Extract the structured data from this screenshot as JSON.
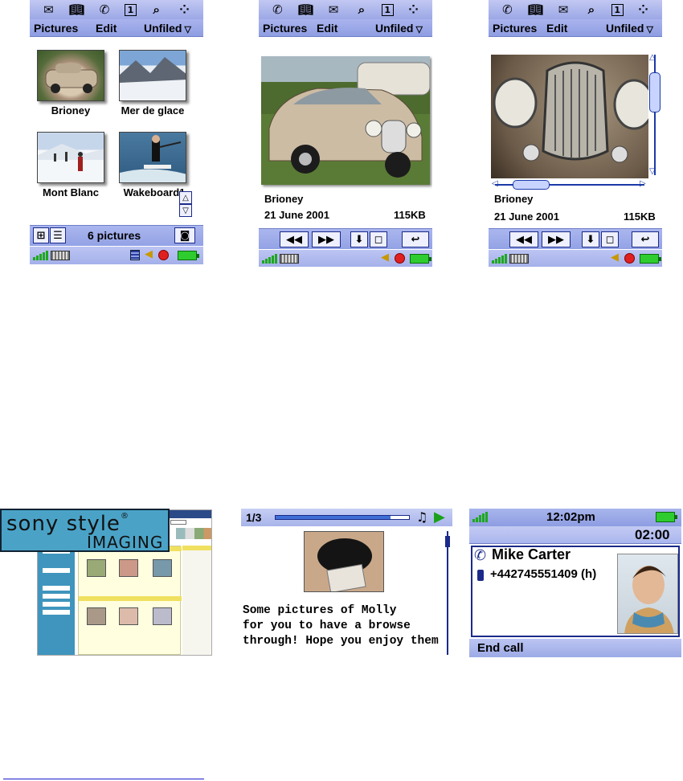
{
  "screens": [
    {
      "icons": [
        "envelope-icon",
        "book-icon",
        "phone-icon",
        "calendar-icon",
        "search-icon",
        "apps-icon"
      ],
      "menu": {
        "pictures": "Pictures",
        "edit": "Edit",
        "folder": "Unfiled"
      },
      "thumbnails": [
        {
          "caption": "Brioney",
          "icon": "car-photo"
        },
        {
          "caption": "Mer de glace",
          "icon": "glacier-photo"
        },
        {
          "caption": "Mont Blanc",
          "icon": "skiers-photo"
        },
        {
          "caption": "Wakeboard1",
          "icon": "wakeboard-photo"
        }
      ],
      "footer_count": "6 pictures"
    },
    {
      "icons": [
        "phone-icon",
        "book-icon",
        "envelope-icon",
        "search-icon",
        "calendar-icon",
        "apps-icon"
      ],
      "menu": {
        "pictures": "Pictures",
        "edit": "Edit",
        "folder": "Unfiled"
      },
      "picture": {
        "name": "Brioney",
        "date": "21 June 2001",
        "size": "115KB"
      }
    },
    {
      "icons": [
        "phone-icon",
        "book-icon",
        "envelope-icon",
        "search-icon",
        "calendar-icon",
        "apps-icon"
      ],
      "menu": {
        "pictures": "Pictures",
        "edit": "Edit",
        "folder": "Unfiled"
      },
      "picture": {
        "name": "Brioney",
        "date": "21 June 2001",
        "size": "115KB"
      }
    }
  ],
  "sony": {
    "title": "sony style",
    "subtitle": "IMAGING",
    "trademark": "®"
  },
  "player": {
    "counter": "1/3",
    "progress": 0.86,
    "message_lines": [
      "Some pictures of Molly",
      "for you to have a browse",
      "through! Hope you enjoy them"
    ]
  },
  "call": {
    "time": "12:02pm",
    "timer": "02:00",
    "name": "Mike Carter",
    "number": "+442745551409 (h)",
    "softkey": "End call"
  },
  "colors": {
    "bar_blue": "#9ca8e6",
    "dark_blue": "#1b2a8a",
    "signal_green": "#1ea81e",
    "battery_green": "#2ecc2e",
    "web_teal": "#4aa3c7"
  }
}
